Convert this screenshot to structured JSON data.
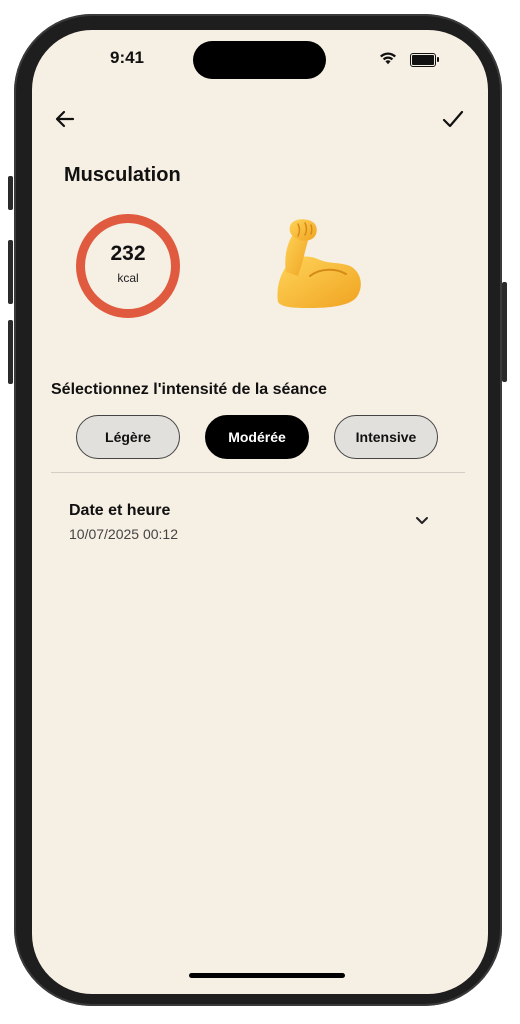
{
  "status_bar": {
    "time": "9:41",
    "icons": [
      "wifi-icon",
      "battery-icon"
    ]
  },
  "header": {
    "back_icon": "arrow-left-icon",
    "confirm_icon": "checkmark-icon"
  },
  "activity": {
    "title": "Musculation",
    "calories_value": "232",
    "calories_unit": "kcal",
    "ring_color": "#e05a3f",
    "emoji": "flexed-biceps-emoji"
  },
  "intensity": {
    "label": "Sélectionnez l'intensité de la séance",
    "options": [
      "Légère",
      "Modérée",
      "Intensive"
    ],
    "selected": "Modérée"
  },
  "datetime": {
    "label": "Date et heure",
    "value": "10/07/2025 00:12",
    "icon": "chevron-down-icon"
  },
  "colors": {
    "background": "#f6efe4",
    "accent": "#e05a3f",
    "selected_pill": "#000000",
    "unselected_pill": "#e2e0dc"
  }
}
